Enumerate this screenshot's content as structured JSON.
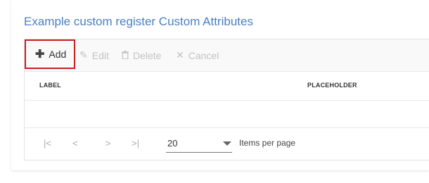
{
  "card": {
    "title": "Example custom register Custom Attributes"
  },
  "toolbar": {
    "add_icon": "plus-icon",
    "add_label": "Add",
    "edit_icon": "pencil-icon",
    "edit_label": "Edit",
    "delete_icon": "trash-icon",
    "delete_label": "Delete",
    "cancel_icon": "close-icon",
    "cancel_label": "Cancel"
  },
  "table": {
    "columns": [
      "LABEL",
      "PLACEHOLDER"
    ],
    "rows": []
  },
  "pager": {
    "first_glyph": "|<",
    "prev_glyph": "<",
    "next_glyph": ">",
    "last_glyph": ">|",
    "page_size": "20",
    "items_per_page_label": "Items per page"
  },
  "colors": {
    "title": "#4a7fc1",
    "highlight_border": "#cc1f1f",
    "disabled": "#c3c3c3"
  }
}
